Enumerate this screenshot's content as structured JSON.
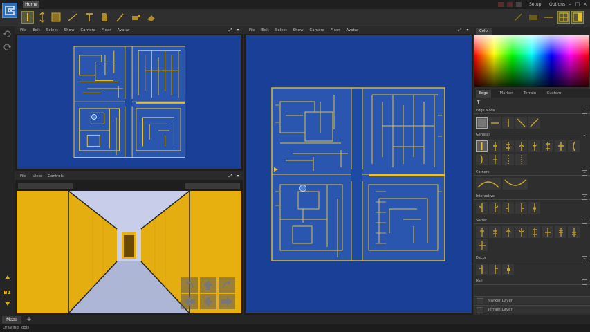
{
  "window": {
    "home_tab": "Home",
    "setup_menu": "Setup",
    "options_menu": "Options"
  },
  "map_view": {
    "menu": [
      "File",
      "Edit",
      "Select",
      "Show",
      "Camera",
      "Floor",
      "Avatar"
    ]
  },
  "first_person_view": {
    "menu": [
      "File",
      "View",
      "Controls"
    ]
  },
  "floor_indicator": "B1",
  "color_panel": {
    "tabs": [
      "Color"
    ]
  },
  "tool_tabs": [
    "Edge",
    "Marker",
    "Terrain",
    "Custom"
  ],
  "sections": {
    "edge_mode": "Edge Mode",
    "general": "General",
    "corners": "Corners",
    "interactive": "Interactive",
    "secret": "Secret",
    "decor": "Decor",
    "hall": "Hall"
  },
  "layers": {
    "marker": "Marker Layer",
    "terrain": "Terrain Layer"
  },
  "bottom_tab": "Maze",
  "status": "Drawing Tools",
  "colors": {
    "map_background": "#1a3f96",
    "wall_line": "#e6c12b",
    "corridor_wall": "#e8b00e",
    "corridor_floor": "#b7bedb",
    "accent": "#e8b400"
  }
}
